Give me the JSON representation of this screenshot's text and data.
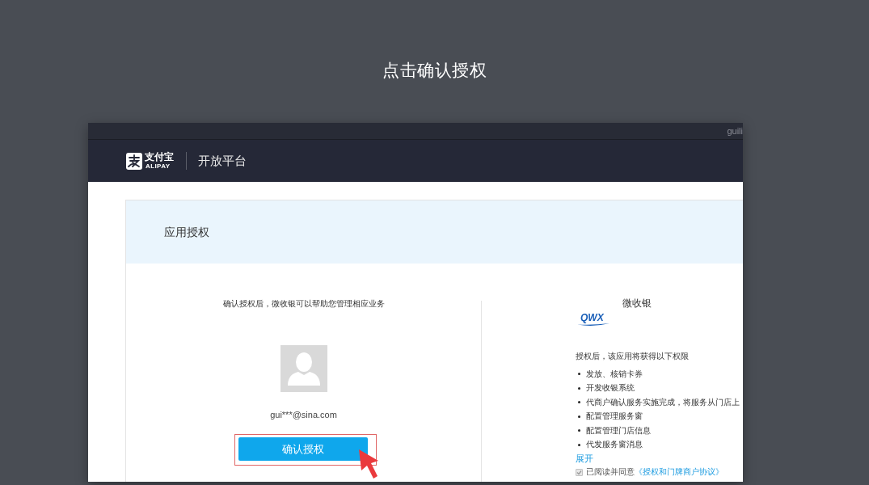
{
  "page": {
    "title": "点击确认授权"
  },
  "screenshot": {
    "top_bar": {
      "user": "guili"
    },
    "header": {
      "logo": {
        "name": "支付宝",
        "subtitle": "ALIPAY"
      },
      "product": "开放平台"
    },
    "card": {
      "title": "应用授权",
      "account": {
        "notice": "确认授权后，微收银可以帮助您管理相应业务",
        "email": "gui***@sina.com",
        "confirm_button": {
          "label": "确认授权",
          "highlighted": true
        }
      },
      "app": {
        "name": "微收银",
        "logo_text": "QWX",
        "permissions_intro": "授权后，该应用将获得以下权限",
        "permissions": [
          "发放、核销卡券",
          "开发收银系统",
          "代商户确认服务实施完成，将服务从门店上",
          "配置管理服务窗",
          "配置管理门店信息",
          "代发服务窗消息"
        ],
        "expand_link": "展开",
        "agreement": {
          "checked": true,
          "text": "已阅读并同意",
          "link": "《授权和门牌商户协议》"
        }
      }
    }
  }
}
